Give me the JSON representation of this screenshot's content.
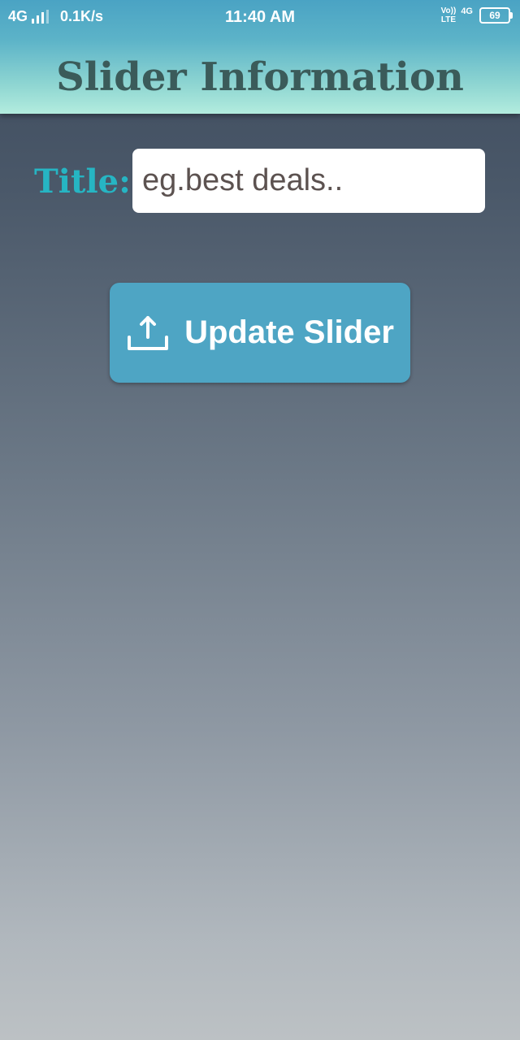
{
  "status_bar": {
    "network_type": "4G",
    "data_speed": "0.1K/s",
    "time": "11:40 AM",
    "volte_top": "Vo))",
    "volte_bottom": "LTE",
    "network_right": "4G",
    "battery_level": "69"
  },
  "header": {
    "title": "Slider Information"
  },
  "form": {
    "title_label": "Title:",
    "title_placeholder": "eg.best deals.."
  },
  "actions": {
    "update_label": "Update Slider",
    "update_icon": "upload-icon"
  },
  "colors": {
    "header_top": "#4aa3c4",
    "header_bottom": "#b3ecde",
    "title_text": "#3b5b5a",
    "label_accent": "#26b5c3",
    "button_bg": "#4ea5c4"
  }
}
